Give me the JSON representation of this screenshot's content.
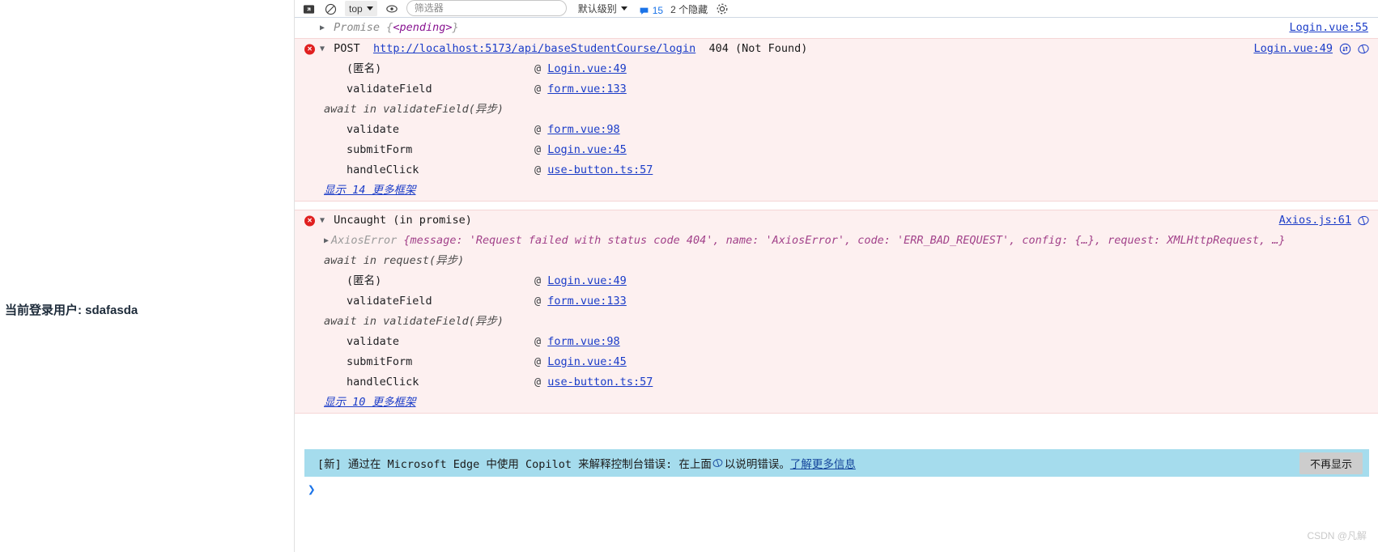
{
  "page": {
    "current_user_label": "当前登录用户: sdafasda",
    "watermark": "CSDN @凡解"
  },
  "devtools": {
    "toolbar": {
      "context_selector": "top",
      "filter_placeholder": "筛选器",
      "level_selector": "默认级别",
      "issue_count": "15",
      "hidden_text": "2 个隐藏",
      "icons": {
        "inspect": "inspect-icon",
        "clear": "clear-console-icon",
        "eye": "eye-icon",
        "settings": "settings-gear-icon"
      }
    },
    "rows": {
      "promise": {
        "expander": "collapsed",
        "object_name": "Promise",
        "object_body": "{<pending>}",
        "pending": "<pending>",
        "source": "Login.vue:55"
      },
      "error1": {
        "badge": "×",
        "expander": "expanded",
        "method": "POST",
        "url": "http://localhost:5173/api/baseStudentCourse/login",
        "status": "404 (Not Found)",
        "source": "Login.vue:49",
        "icons": [
          "network-request-icon",
          "copilot-explain-icon"
        ],
        "frames": [
          {
            "fn": "(匿名)",
            "at": "@",
            "loc": "Login.vue:49"
          },
          {
            "fn": "validateField",
            "at": "@",
            "loc": "form.vue:133"
          },
          {
            "await": "await in validateField(异步)"
          },
          {
            "fn": "validate",
            "at": "@",
            "loc": "form.vue:98"
          },
          {
            "fn": "submitForm",
            "at": "@",
            "loc": "Login.vue:45"
          },
          {
            "fn": "handleClick",
            "at": "@",
            "loc": "use-button.ts:57"
          }
        ],
        "more_frames": "显示 14 更多框架"
      },
      "error2": {
        "badge": "×",
        "expander": "expanded",
        "title": "Uncaught (in promise)",
        "source": "Axios.js:61",
        "icons": [
          "copilot-explain-icon"
        ],
        "object_name": "AxiosError",
        "object_detail": "{message: 'Request failed with status code 404', name: 'AxiosError', code: 'ERR_BAD_REQUEST', config: {…}, request: XMLHttpRequest, …}",
        "frames": [
          {
            "await": "await in request(异步)"
          },
          {
            "fn": "(匿名)",
            "at": "@",
            "loc": "Login.vue:49"
          },
          {
            "fn": "validateField",
            "at": "@",
            "loc": "form.vue:133"
          },
          {
            "await": "await in validateField(异步)"
          },
          {
            "fn": "validate",
            "at": "@",
            "loc": "form.vue:98"
          },
          {
            "fn": "submitForm",
            "at": "@",
            "loc": "Login.vue:45"
          },
          {
            "fn": "handleClick",
            "at": "@",
            "loc": "use-button.ts:57"
          }
        ],
        "more_frames": "显示 10 更多框架"
      }
    },
    "copilot_banner": {
      "text_before": "[新] 通过在 Microsoft Edge 中使用 Copilot 来解释控制台错误: 在上面 ",
      "icon": "copilot-explain-icon",
      "text_after": " 以说明错误。",
      "link": "了解更多信息",
      "dismiss_label": "不再显示"
    },
    "prompt": {
      "chevron": "❯"
    }
  },
  "colors": {
    "error_bg": "#fdf0f0",
    "error_border": "#f5d6d6",
    "error_badge": "#e02020",
    "link": "#1a3cc8",
    "banner_bg": "#a5dced",
    "accent": "#1a73e8"
  }
}
